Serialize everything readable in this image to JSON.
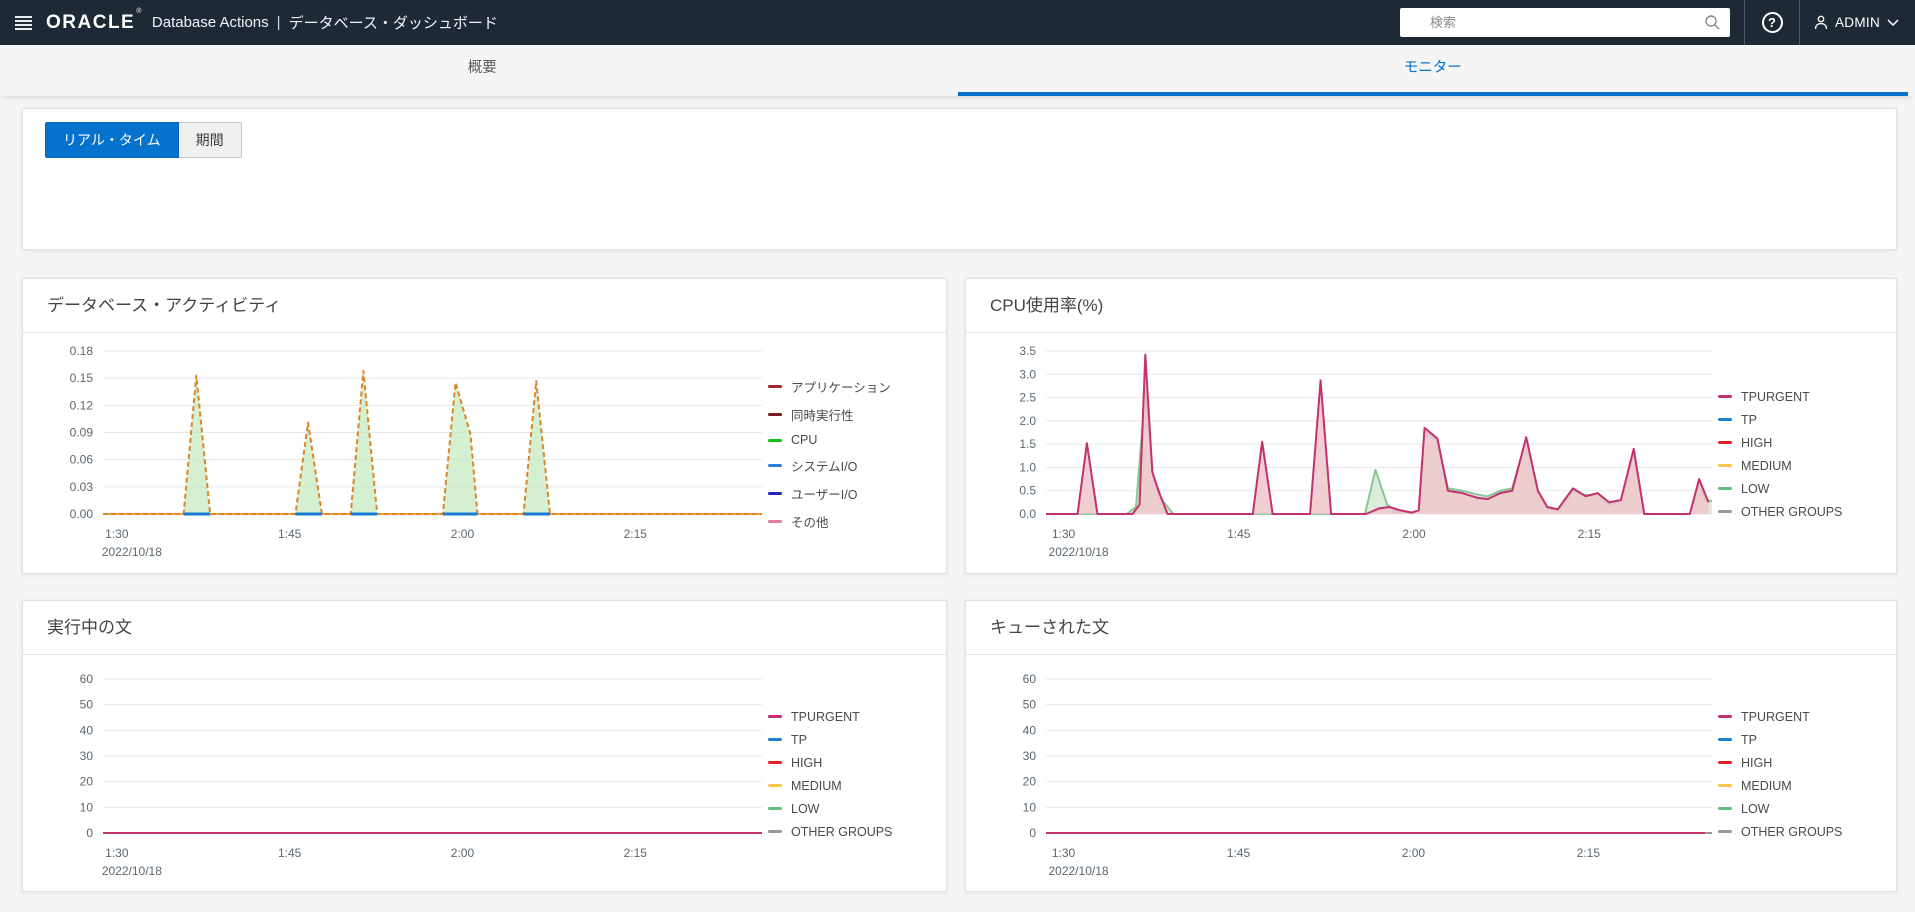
{
  "header": {
    "brand": "ORACLE",
    "brand_reg": "®",
    "product": "Database Actions",
    "separator": "|",
    "page_title": "データベース・ダッシュボード",
    "search_placeholder": "検索",
    "help_glyph": "?",
    "user_label": "ADMIN"
  },
  "tabs": [
    {
      "label": "概要",
      "active": false
    },
    {
      "label": "モニター",
      "active": true
    }
  ],
  "toolbar": {
    "realtime_label": "リアル・タイム",
    "period_label": "期間"
  },
  "colors": {
    "header_bg": "#1d2a36",
    "accent_blue": "#0572ce",
    "page_bg": "#f5f5f5"
  },
  "chart_data": [
    {
      "type": "area",
      "title": "データベース・アクティビティ",
      "ylim": [
        0,
        0.18
      ],
      "x_range": [
        88.8,
        146
      ],
      "margins": {
        "l": 80,
        "r": 6,
        "t": 18,
        "b": 61
      },
      "yticks": [
        {
          "v": 0.18,
          "label": "0.18"
        },
        {
          "v": 0.15,
          "label": "0.15"
        },
        {
          "v": 0.12,
          "label": "0.12"
        },
        {
          "v": 0.09,
          "label": "0.09"
        },
        {
          "v": 0.06,
          "label": "0.06"
        },
        {
          "v": 0.03,
          "label": "0.03"
        },
        {
          "v": 0.0,
          "label": "0.00"
        }
      ],
      "xticks": [
        {
          "v": 90,
          "label": "1:30",
          "sub": "2022/10/18"
        },
        {
          "v": 105,
          "label": "1:45"
        },
        {
          "v": 120,
          "label": "2:00"
        },
        {
          "v": 135,
          "label": "2:15"
        }
      ],
      "legend": [
        {
          "label": "アプリケーション",
          "color": "#a8232e"
        },
        {
          "label": "同時実行性",
          "color": "#7b1c24"
        },
        {
          "label": "CPU",
          "color": "#0fc117"
        },
        {
          "label": "システムI/O",
          "color": "#2a7de1"
        },
        {
          "label": "ユーザーI/O",
          "color": "#1f25c9"
        },
        {
          "label": "その他",
          "color": "#e07ba4"
        }
      ],
      "series": [
        {
          "name": "baseline-medium",
          "color": "#f0a144",
          "width": 2,
          "points": [
            [
              88.8,
              0
            ],
            [
              146,
              0
            ]
          ]
        },
        {
          "name": "CPU",
          "color": "#dd8627",
          "width": 2,
          "dash": "5 3",
          "fill": "#c3e8bd",
          "fill_opacity": 0.7,
          "points": [
            [
              88.8,
              0
            ],
            [
              95.8,
              0
            ],
            [
              96.9,
              0.153
            ],
            [
              98.1,
              0
            ],
            [
              105.5,
              0
            ],
            [
              106.6,
              0.101
            ],
            [
              107.8,
              0
            ],
            [
              110.3,
              0
            ],
            [
              111.4,
              0.158
            ],
            [
              112.6,
              0
            ],
            [
              118.3,
              0
            ],
            [
              119.4,
              0.145
            ],
            [
              120.7,
              0.088
            ],
            [
              121.3,
              0
            ],
            [
              125.3,
              0
            ],
            [
              126.4,
              0.147
            ],
            [
              127.6,
              0
            ],
            [
              146,
              0
            ]
          ]
        },
        {
          "name": "システムI/O-seg1",
          "color": "#1779d0",
          "width": 3,
          "points": [
            [
              95.8,
              0
            ],
            [
              98.1,
              0
            ]
          ]
        },
        {
          "name": "システムI/O-seg2",
          "color": "#1779d0",
          "width": 3,
          "points": [
            [
              105.5,
              0
            ],
            [
              107.8,
              0
            ]
          ]
        },
        {
          "name": "システムI/O-seg3",
          "color": "#1779d0",
          "width": 3,
          "points": [
            [
              110.3,
              0
            ],
            [
              112.6,
              0
            ]
          ]
        },
        {
          "name": "システムI/O-seg4",
          "color": "#1779d0",
          "width": 3,
          "points": [
            [
              118.3,
              0
            ],
            [
              121.3,
              0
            ]
          ]
        },
        {
          "name": "システムI/O-seg5",
          "color": "#1779d0",
          "width": 3,
          "points": [
            [
              125.3,
              0
            ],
            [
              127.6,
              0
            ]
          ]
        }
      ]
    },
    {
      "type": "area",
      "title": "CPU使用率(%)",
      "ylim": [
        0,
        3.5
      ],
      "x_range": [
        88.5,
        145.5
      ],
      "margins": {
        "l": 80,
        "r": 6,
        "t": 18,
        "b": 61
      },
      "yticks": [
        {
          "v": 3.5,
          "label": "3.5"
        },
        {
          "v": 3.0,
          "label": "3.0"
        },
        {
          "v": 2.5,
          "label": "2.5"
        },
        {
          "v": 2.0,
          "label": "2.0"
        },
        {
          "v": 1.5,
          "label": "1.5"
        },
        {
          "v": 1.0,
          "label": "1.0"
        },
        {
          "v": 0.5,
          "label": "0.5"
        },
        {
          "v": 0.0,
          "label": "0.0"
        }
      ],
      "xticks": [
        {
          "v": 90,
          "label": "1:30",
          "sub": "2022/10/18"
        },
        {
          "v": 105,
          "label": "1:45"
        },
        {
          "v": 120,
          "label": "2:00"
        },
        {
          "v": 135,
          "label": "2:15"
        }
      ],
      "legend": [
        {
          "label": "TPURGENT",
          "color": "#c5306e"
        },
        {
          "label": "TP",
          "color": "#1b7fd4"
        },
        {
          "label": "HIGH",
          "color": "#ed1c24"
        },
        {
          "label": "MEDIUM",
          "color": "#f6c64d"
        },
        {
          "label": "LOW",
          "color": "#64bd7c"
        },
        {
          "label": "OTHER GROUPS",
          "color": "#999999"
        }
      ],
      "series": [
        {
          "name": "LOW",
          "color": "#86c796",
          "width": 2,
          "fill": "#cfe6cd",
          "fill_opacity": 0.7,
          "points": [
            [
              88.5,
              0
            ],
            [
              95.4,
              0
            ],
            [
              96.2,
              0.15
            ],
            [
              97,
              2.62
            ],
            [
              97.7,
              0.7
            ],
            [
              98.5,
              0.28
            ],
            [
              99.4,
              0
            ],
            [
              115.8,
              0
            ],
            [
              116.7,
              0.95
            ],
            [
              117.7,
              0.2
            ],
            [
              118.5,
              0.05
            ],
            [
              119.8,
              0.02
            ],
            [
              120.4,
              0.06
            ],
            [
              120.9,
              1.8
            ],
            [
              122,
              1.55
            ],
            [
              122.9,
              0.55
            ],
            [
              124.1,
              0.5
            ],
            [
              125.4,
              0.42
            ],
            [
              126.3,
              0.38
            ],
            [
              127.4,
              0.5
            ],
            [
              128.4,
              0.55
            ],
            [
              129.6,
              1.6
            ],
            [
              130.6,
              0.45
            ],
            [
              131.4,
              0.12
            ],
            [
              132.3,
              0.08
            ],
            [
              133.6,
              0.5
            ],
            [
              134.7,
              0.4
            ],
            [
              135.7,
              0.42
            ],
            [
              136.7,
              0.2
            ],
            [
              137.7,
              0.28
            ],
            [
              138.8,
              1.35
            ],
            [
              139.7,
              0
            ],
            [
              143.6,
              0
            ],
            [
              144.4,
              0.7
            ],
            [
              144.9,
              0.3
            ],
            [
              145.5,
              0.28
            ]
          ]
        },
        {
          "name": "TPURGENT",
          "color": "#c5306e",
          "width": 2,
          "fill": "#eec6ca",
          "fill_opacity": 0.85,
          "points": [
            [
              88.5,
              0
            ],
            [
              91.2,
              0
            ],
            [
              92,
              1.52
            ],
            [
              92.9,
              0
            ],
            [
              95.9,
              0
            ],
            [
              96.5,
              0.2
            ],
            [
              97,
              3.42
            ],
            [
              97.6,
              0.9
            ],
            [
              98.2,
              0.45
            ],
            [
              98.9,
              0
            ],
            [
              106.2,
              0
            ],
            [
              107,
              1.55
            ],
            [
              107.9,
              0
            ],
            [
              111.1,
              0
            ],
            [
              112,
              2.87
            ],
            [
              112.9,
              0
            ],
            [
              115.9,
              0
            ],
            [
              117,
              0.12
            ],
            [
              117.9,
              0.15
            ],
            [
              118.8,
              0.08
            ],
            [
              119.8,
              0.03
            ],
            [
              120.4,
              0.08
            ],
            [
              120.9,
              1.85
            ],
            [
              122,
              1.62
            ],
            [
              122.9,
              0.5
            ],
            [
              124.1,
              0.45
            ],
            [
              125.4,
              0.35
            ],
            [
              126.3,
              0.32
            ],
            [
              127.4,
              0.45
            ],
            [
              128.4,
              0.5
            ],
            [
              129.6,
              1.65
            ],
            [
              130.6,
              0.5
            ],
            [
              131.4,
              0.15
            ],
            [
              132.3,
              0.1
            ],
            [
              133.6,
              0.55
            ],
            [
              134.7,
              0.38
            ],
            [
              135.7,
              0.45
            ],
            [
              136.7,
              0.25
            ],
            [
              137.7,
              0.3
            ],
            [
              138.8,
              1.4
            ],
            [
              139.7,
              0
            ],
            [
              143.6,
              0
            ],
            [
              144.4,
              0.75
            ],
            [
              145.2,
              0.25
            ]
          ]
        }
      ]
    },
    {
      "type": "line",
      "title": "実行中の文",
      "ylim": [
        0,
        60
      ],
      "x_range": [
        88.8,
        146
      ],
      "margins": {
        "l": 80,
        "r": 6,
        "t": 24,
        "b": 60
      },
      "yticks": [
        {
          "v": 60,
          "label": "60"
        },
        {
          "v": 50,
          "label": "50"
        },
        {
          "v": 40,
          "label": "40"
        },
        {
          "v": 30,
          "label": "30"
        },
        {
          "v": 20,
          "label": "20"
        },
        {
          "v": 10,
          "label": "10"
        },
        {
          "v": 0,
          "label": "0"
        }
      ],
      "xticks": [
        {
          "v": 90,
          "label": "1:30",
          "sub": "2022/10/18"
        },
        {
          "v": 105,
          "label": "1:45"
        },
        {
          "v": 120,
          "label": "2:00"
        },
        {
          "v": 135,
          "label": "2:15"
        }
      ],
      "legend": [
        {
          "label": "TPURGENT",
          "color": "#c5306e"
        },
        {
          "label": "TP",
          "color": "#1b7fd4"
        },
        {
          "label": "HIGH",
          "color": "#ed1c24"
        },
        {
          "label": "MEDIUM",
          "color": "#f6c64d"
        },
        {
          "label": "LOW",
          "color": "#64bd7c"
        },
        {
          "label": "OTHER GROUPS",
          "color": "#999999"
        }
      ],
      "series": [
        {
          "name": "OTHER GROUPS",
          "color": "#999999",
          "width": 2,
          "points": [
            [
              88.8,
              0
            ],
            [
              146,
              0
            ]
          ]
        },
        {
          "name": "TPURGENT",
          "color": "#c5306e",
          "width": 2,
          "points": [
            [
              88.8,
              0
            ],
            [
              146,
              0
            ]
          ]
        }
      ]
    },
    {
      "type": "line",
      "title": "キューされた文",
      "ylim": [
        0,
        60
      ],
      "x_range": [
        88.5,
        145.6
      ],
      "margins": {
        "l": 80,
        "r": 6,
        "t": 24,
        "b": 60
      },
      "yticks": [
        {
          "v": 60,
          "label": "60"
        },
        {
          "v": 50,
          "label": "50"
        },
        {
          "v": 40,
          "label": "40"
        },
        {
          "v": 30,
          "label": "30"
        },
        {
          "v": 20,
          "label": "20"
        },
        {
          "v": 10,
          "label": "10"
        },
        {
          "v": 0,
          "label": "0"
        }
      ],
      "xticks": [
        {
          "v": 90,
          "label": "1:30",
          "sub": "2022/10/18"
        },
        {
          "v": 105,
          "label": "1:45"
        },
        {
          "v": 120,
          "label": "2:00"
        },
        {
          "v": 135,
          "label": "2:15"
        }
      ],
      "legend": [
        {
          "label": "TPURGENT",
          "color": "#c5306e"
        },
        {
          "label": "TP",
          "color": "#1b7fd4"
        },
        {
          "label": "HIGH",
          "color": "#ed1c24"
        },
        {
          "label": "MEDIUM",
          "color": "#f6c64d"
        },
        {
          "label": "LOW",
          "color": "#64bd7c"
        },
        {
          "label": "OTHER GROUPS",
          "color": "#999999"
        }
      ],
      "series": [
        {
          "name": "OTHER GROUPS",
          "color": "#999999",
          "width": 2,
          "points": [
            [
              88.5,
              0
            ],
            [
              145.6,
              0
            ]
          ]
        },
        {
          "name": "TPURGENT",
          "color": "#c5306e",
          "width": 2,
          "points": [
            [
              88.5,
              0
            ],
            [
              145,
              0
            ]
          ]
        }
      ]
    }
  ]
}
